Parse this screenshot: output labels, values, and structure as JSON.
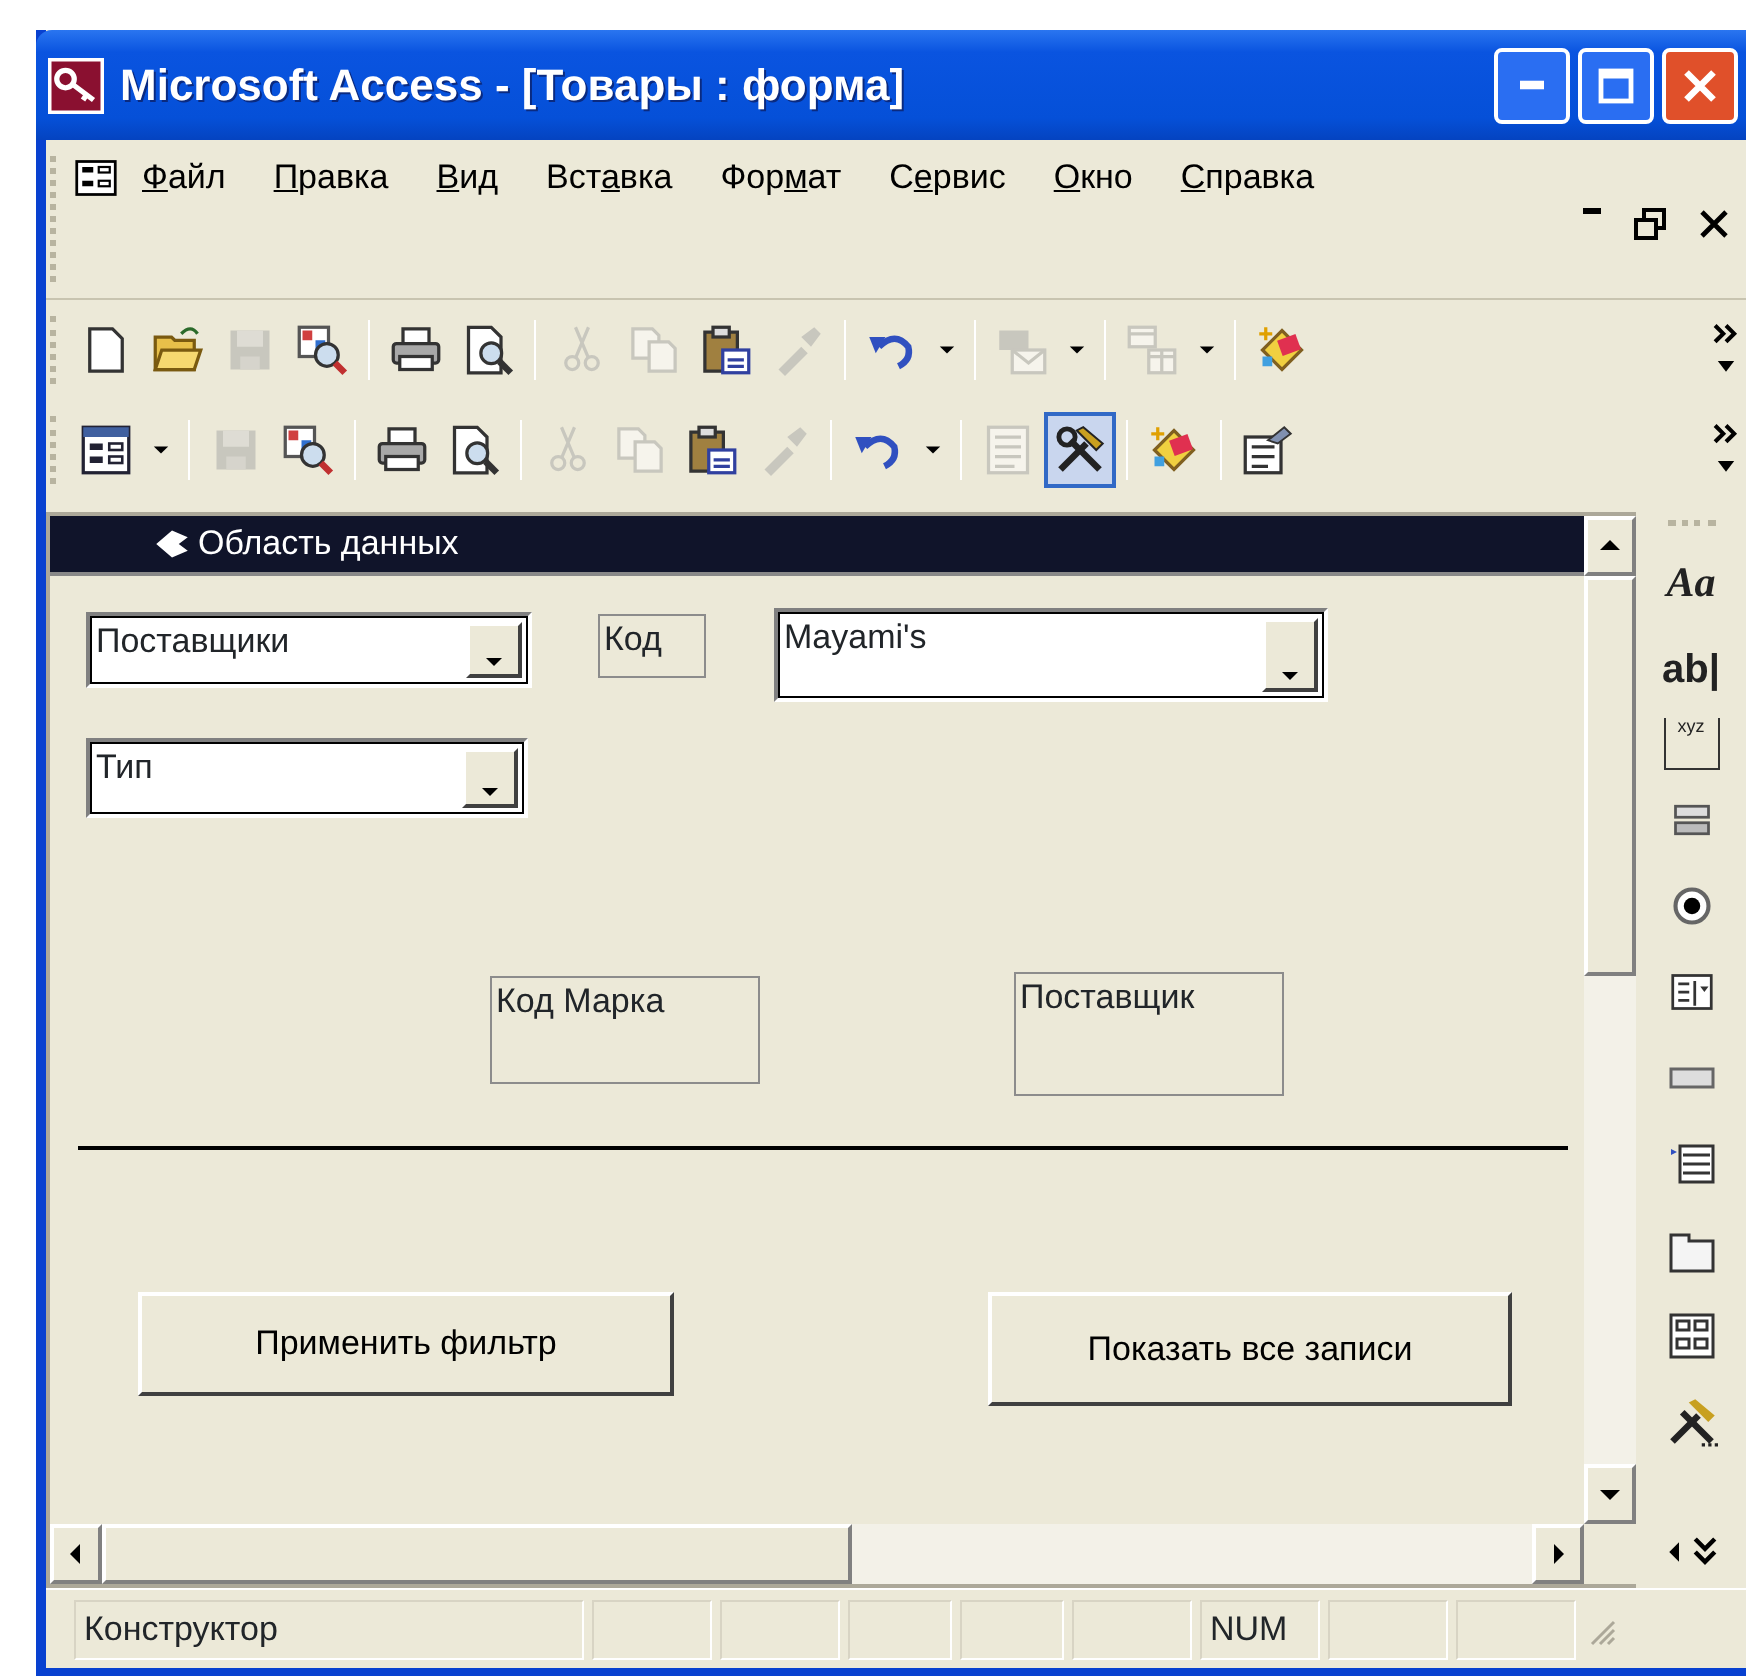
{
  "window": {
    "title": "Microsoft Access - [Товары : форма]"
  },
  "menu": [
    {
      "key": "Ф",
      "post": "айл"
    },
    {
      "key": "П",
      "post": "равка"
    },
    {
      "key": "В",
      "post": "ид"
    },
    {
      "pre": "Вст",
      "key": "а",
      "post": "вка"
    },
    {
      "pre": "Фор",
      "key": "м",
      "post": "ат"
    },
    {
      "pre": "С",
      "key": "е",
      "post": "рвис"
    },
    {
      "key": "О",
      "post": "кно"
    },
    {
      "key": "С",
      "post": "правка"
    }
  ],
  "toolbars": [
    [
      {
        "kind": "new",
        "disabled": false,
        "pressed": false
      },
      {
        "kind": "open",
        "disabled": false,
        "pressed": false
      },
      {
        "kind": "save",
        "disabled": true,
        "pressed": false
      },
      {
        "kind": "search",
        "disabled": false,
        "pressed": false
      },
      {
        "kind": "separator"
      },
      {
        "kind": "print",
        "disabled": false,
        "pressed": false
      },
      {
        "kind": "preview",
        "disabled": false,
        "pressed": false
      },
      {
        "kind": "separator"
      },
      {
        "kind": "cut",
        "disabled": true,
        "pressed": false
      },
      {
        "kind": "copy",
        "disabled": true,
        "pressed": false
      },
      {
        "kind": "paste",
        "disabled": false,
        "pressed": false
      },
      {
        "kind": "painter",
        "disabled": true,
        "pressed": false
      },
      {
        "kind": "separator"
      },
      {
        "kind": "undo",
        "disabled": false,
        "pressed": false
      },
      {
        "kind": "dropdown"
      },
      {
        "kind": "separator"
      },
      {
        "kind": "links",
        "disabled": true,
        "pressed": false
      },
      {
        "kind": "dropdown"
      },
      {
        "kind": "separator"
      },
      {
        "kind": "tables",
        "disabled": true,
        "pressed": false
      },
      {
        "kind": "dropdown"
      },
      {
        "kind": "separator"
      },
      {
        "kind": "wand",
        "disabled": false,
        "pressed": false
      },
      {
        "kind": "overflow"
      }
    ],
    [
      {
        "kind": "view",
        "disabled": false,
        "pressed": false
      },
      {
        "kind": "dropdown"
      },
      {
        "kind": "separator"
      },
      {
        "kind": "save",
        "disabled": true,
        "pressed": false
      },
      {
        "kind": "search",
        "disabled": false,
        "pressed": false
      },
      {
        "kind": "separator"
      },
      {
        "kind": "print",
        "disabled": false,
        "pressed": false
      },
      {
        "kind": "preview",
        "disabled": false,
        "pressed": false
      },
      {
        "kind": "separator"
      },
      {
        "kind": "cut",
        "disabled": true,
        "pressed": false
      },
      {
        "kind": "copy",
        "disabled": true,
        "pressed": false
      },
      {
        "kind": "paste",
        "disabled": false,
        "pressed": false
      },
      {
        "kind": "painter",
        "disabled": true,
        "pressed": false
      },
      {
        "kind": "separator"
      },
      {
        "kind": "undo",
        "disabled": false,
        "pressed": false
      },
      {
        "kind": "dropdown"
      },
      {
        "kind": "separator"
      },
      {
        "kind": "fieldlist",
        "disabled": true,
        "pressed": false
      },
      {
        "kind": "tools",
        "disabled": false,
        "pressed": true
      },
      {
        "kind": "separator"
      },
      {
        "kind": "wand",
        "disabled": false,
        "pressed": false
      },
      {
        "kind": "separator"
      },
      {
        "kind": "properties",
        "disabled": false,
        "pressed": false
      },
      {
        "kind": "overflow"
      }
    ]
  ],
  "form": {
    "section_title": "Область данных",
    "controls": [
      {
        "kind": "combo",
        "text": "Поставщики"
      },
      {
        "kind": "label",
        "text": "Код"
      },
      {
        "kind": "combo",
        "text": "Mayami's"
      },
      {
        "kind": "combo",
        "text": "Тип"
      },
      {
        "kind": "label",
        "text": "Код Марка"
      },
      {
        "kind": "label",
        "text": "Поставщик"
      },
      {
        "kind": "line"
      },
      {
        "kind": "button",
        "text": "Применить фильтр"
      },
      {
        "kind": "button",
        "text": "Показать все записи"
      }
    ]
  },
  "toolbox": [
    {
      "kind": "label",
      "text": "Aa"
    },
    {
      "kind": "textbox",
      "text": "ab|"
    },
    {
      "kind": "frame",
      "text": "xyz"
    },
    {
      "kind": "toggle"
    },
    {
      "kind": "radio"
    },
    {
      "kind": "combo"
    },
    {
      "kind": "button"
    },
    {
      "kind": "list"
    },
    {
      "kind": "tab"
    },
    {
      "kind": "subform"
    },
    {
      "kind": "tools"
    },
    {
      "kind": "more"
    }
  ],
  "status_bar": {
    "mode": "Конструктор",
    "indicator": "NUM"
  }
}
